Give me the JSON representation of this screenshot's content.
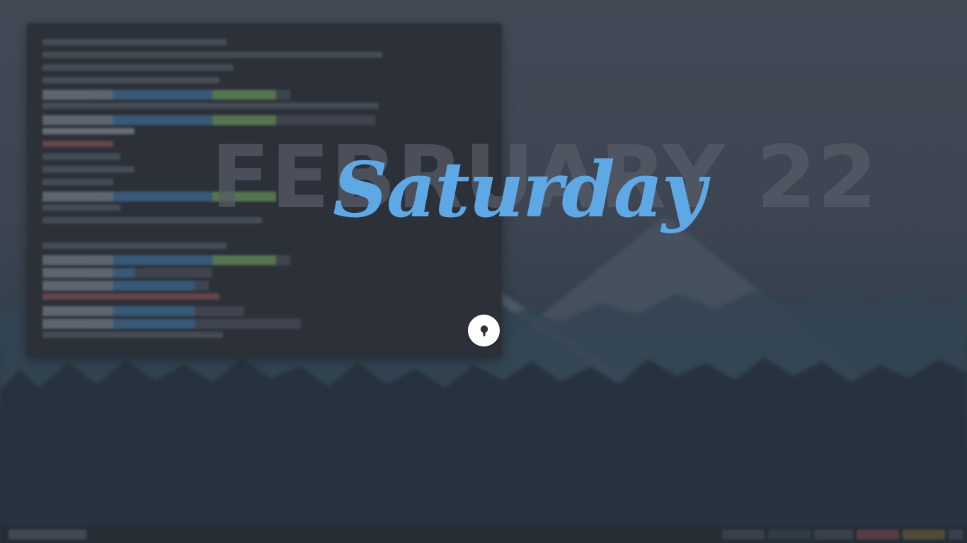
{
  "lockscreen": {
    "date": "FEBRUARY 22",
    "day": "Saturday"
  },
  "icons": {
    "unlock": "keyhole-icon"
  },
  "colors": {
    "day_text": "#5fa8e6",
    "date_text": "#565c67",
    "unlock_button": "#ffffff",
    "keyhole": "#2b3039"
  }
}
